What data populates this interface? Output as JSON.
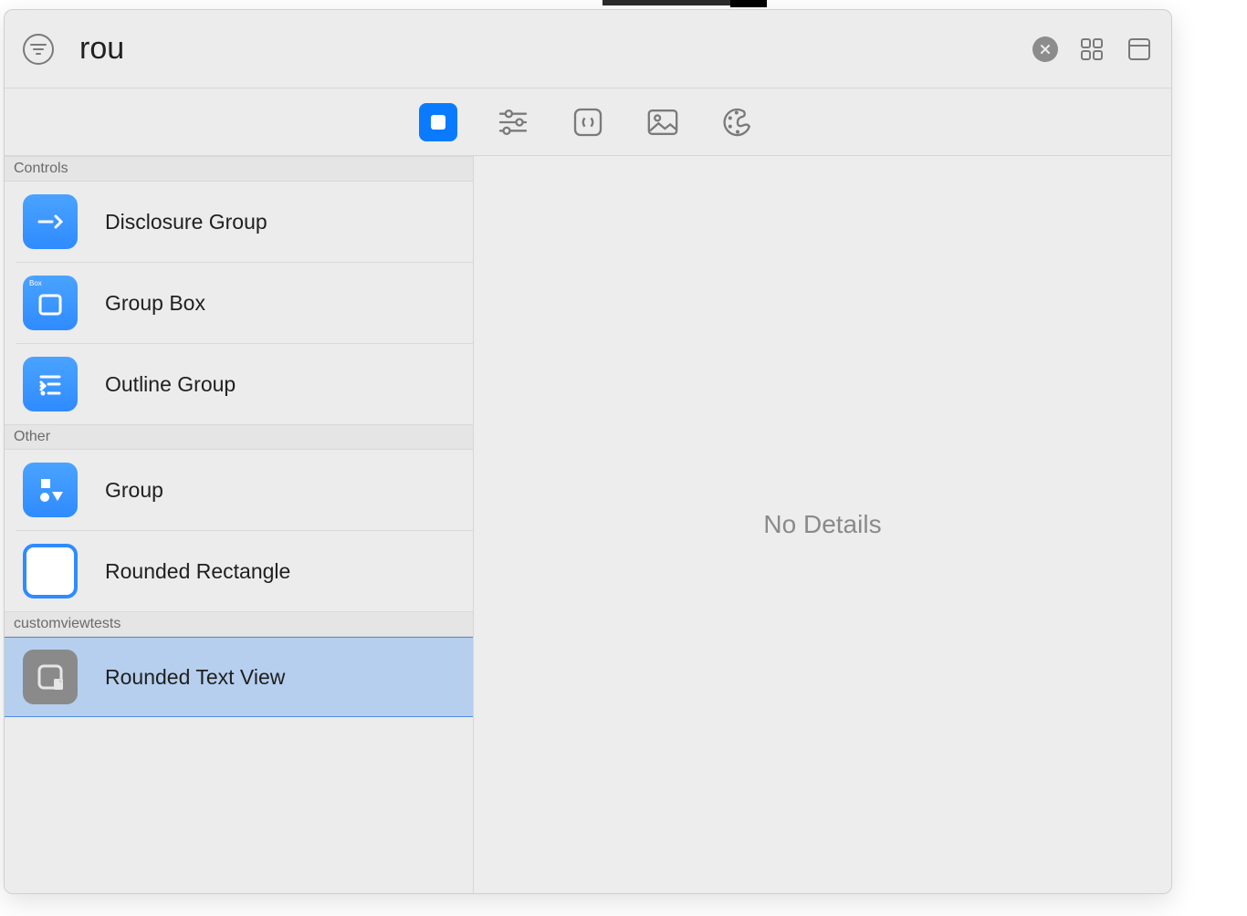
{
  "search": {
    "value": "rou",
    "placeholder": ""
  },
  "tabs": {
    "objects_selected": true
  },
  "detail": {
    "empty_text": "No Details"
  },
  "sections": [
    {
      "title": "Controls",
      "items": [
        {
          "label": "Disclosure Group",
          "icon": "disclosure",
          "selected": false
        },
        {
          "label": "Group Box",
          "icon": "groupbox",
          "selected": false
        },
        {
          "label": "Outline Group",
          "icon": "outline",
          "selected": false
        }
      ]
    },
    {
      "title": "Other",
      "items": [
        {
          "label": "Group",
          "icon": "shapes",
          "selected": false
        },
        {
          "label": "Rounded Rectangle",
          "icon": "roundedrect",
          "selected": false
        }
      ]
    },
    {
      "title": "customviewtests",
      "items": [
        {
          "label": "Rounded Text View",
          "icon": "customview",
          "selected": true
        }
      ]
    }
  ]
}
